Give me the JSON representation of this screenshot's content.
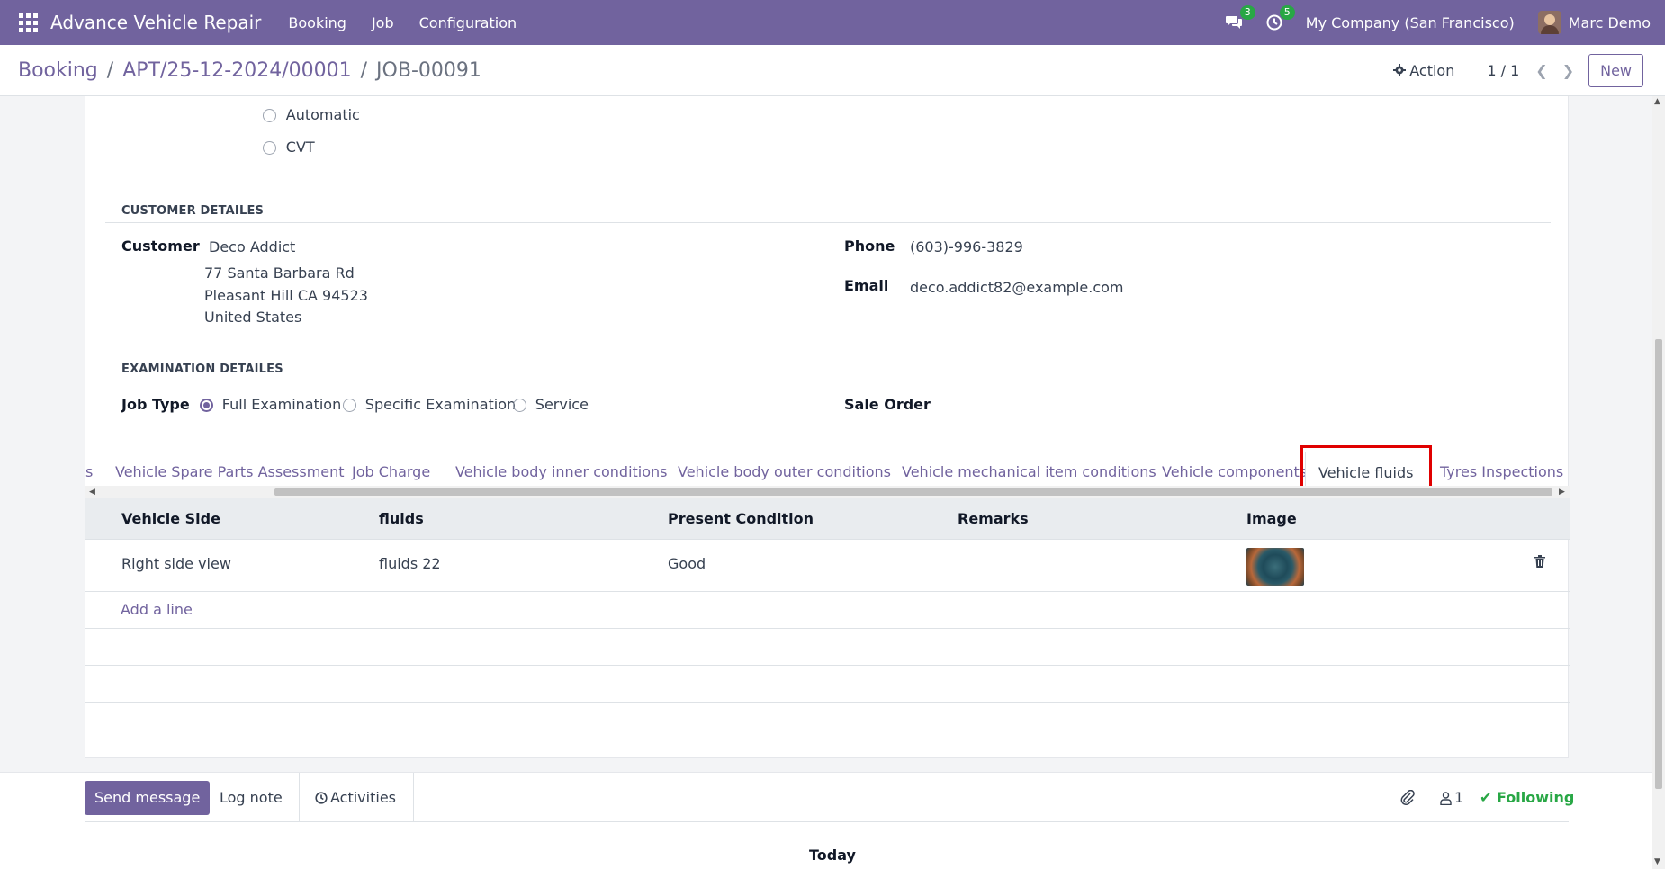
{
  "navbar": {
    "app_title": "Advance Vehicle Repair",
    "menus": [
      "Booking",
      "Job",
      "Configuration"
    ],
    "messages_count": "3",
    "activities_count": "5",
    "company": "My Company (San Francisco)",
    "user": "Marc Demo"
  },
  "breadcrumb": {
    "root": "Booking",
    "parent": "APT/25-12-2024/00001",
    "current": "JOB-00091",
    "separator": "/"
  },
  "control": {
    "action_label": "Action",
    "pager": "1 / 1",
    "new_label": "New"
  },
  "transmission": {
    "options": [
      "Automatic",
      "CVT"
    ]
  },
  "customer_section": {
    "title": "CUSTOMER DETAILES",
    "customer_label": "Customer",
    "customer_name": "Deco Addict",
    "address_line1": "77 Santa Barbara Rd",
    "address_line2": "Pleasant Hill CA 94523",
    "address_line3": "United States",
    "phone_label": "Phone",
    "phone": "(603)-996-3829",
    "email_label": "Email",
    "email": "deco.addict82@example.com"
  },
  "examination_section": {
    "title": "EXAMINATION DETAILES",
    "job_type_label": "Job Type",
    "job_type_options": [
      "Full Examination",
      "Specific Examination",
      "Service"
    ],
    "job_type_selected": "Full Examination",
    "sale_order_label": "Sale Order"
  },
  "tabs": {
    "partial": "s",
    "items": [
      "Vehicle Spare Parts Assessment",
      "Job Charge",
      "Vehicle body inner conditions",
      "Vehicle body outer conditions",
      "Vehicle mechanical item conditions",
      "Vehicle components",
      "Vehicle fluids",
      "Tyres Inspections"
    ],
    "active": "Vehicle fluids"
  },
  "fluids_table": {
    "columns": [
      "Vehicle Side",
      "fluids",
      "Present Condition",
      "Remarks",
      "Image"
    ],
    "rows": [
      {
        "vehicle_side": "Right side view",
        "fluids": "fluids 22",
        "present_condition": "Good",
        "remarks": ""
      }
    ],
    "add_line_label": "Add a line"
  },
  "chatter": {
    "send_message": "Send message",
    "log_note": "Log note",
    "activities": "Activities",
    "followers_count": "1",
    "following": "Following",
    "today": "Today"
  },
  "colors": {
    "brand": "#71639e",
    "following": "#28a745",
    "highlight": "#e00000"
  }
}
